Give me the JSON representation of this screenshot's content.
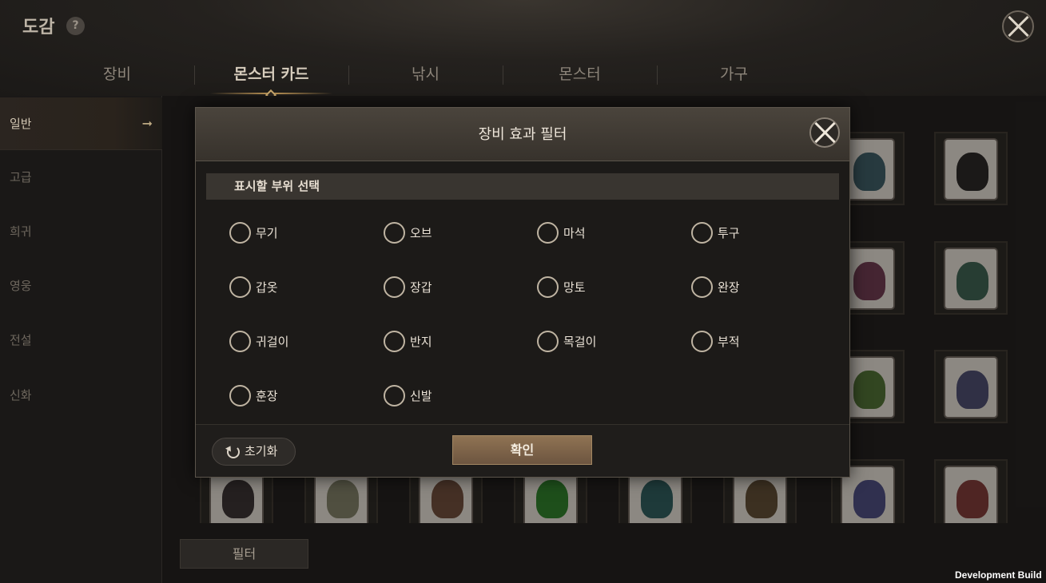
{
  "header": {
    "title": "도감",
    "help_icon": "?",
    "tabs": [
      {
        "label": "장비",
        "active": false
      },
      {
        "label": "몬스터 카드",
        "active": true
      },
      {
        "label": "낚시",
        "active": false
      },
      {
        "label": "몬스터",
        "active": false
      },
      {
        "label": "가구",
        "active": false
      }
    ]
  },
  "sidebar": {
    "items": [
      {
        "label": "일반",
        "active": true
      },
      {
        "label": "고급",
        "active": false
      },
      {
        "label": "희귀",
        "active": false
      },
      {
        "label": "영웅",
        "active": false
      },
      {
        "label": "전설",
        "active": false
      },
      {
        "label": "신화",
        "active": false
      }
    ]
  },
  "footer": {
    "filter_label": "필터",
    "dev_build": "Development Build"
  },
  "modal": {
    "title": "장비 효과 필터",
    "section_label": "표시할 부위 선택",
    "options": [
      "무기",
      "오브",
      "마석",
      "투구",
      "갑옷",
      "장갑",
      "망토",
      "완장",
      "귀걸이",
      "반지",
      "목걸이",
      "부적",
      "훈장",
      "신발"
    ],
    "reset_label": "초기화",
    "confirm_label": "확인"
  },
  "colors": {
    "accent_gold": "#c49a58",
    "confirm_button": "#7e6349",
    "background": "#151312"
  },
  "icons": {
    "close": "close-icon",
    "help": "help-icon",
    "reset": "reset-icon",
    "arrow": "arrow-right-icon"
  }
}
